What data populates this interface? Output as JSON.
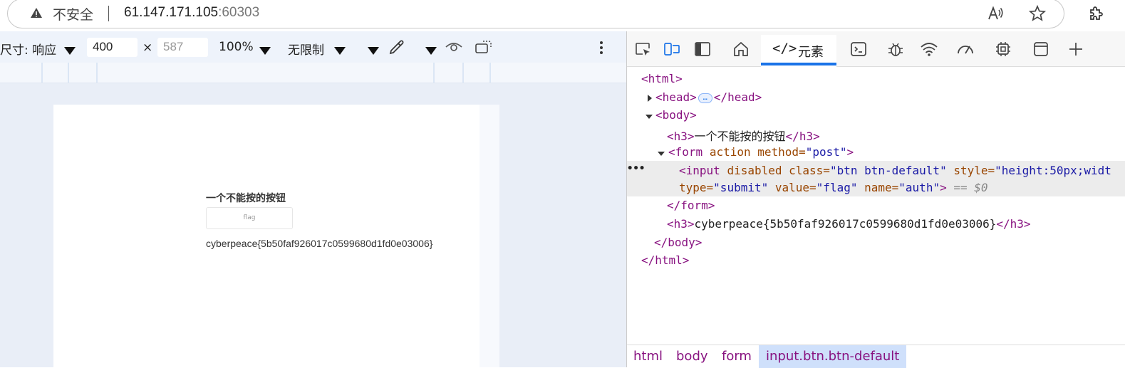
{
  "address_bar": {
    "security_label": "不安全",
    "url_host": "61.147.171.105",
    "url_port": ":60303"
  },
  "device_toolbar": {
    "size_label": "尺寸: 响应",
    "width": "400",
    "height_placeholder": "587",
    "zoom": "100%",
    "throttle": "无限制"
  },
  "page_preview": {
    "heading": "一个不能按的按钮",
    "button_label": "flag",
    "flag_text": "cyberpeace{5b50faf926017c0599680d1fd0e03006}"
  },
  "devtools": {
    "active_tab": "元素",
    "tab_code_icon": "</>",
    "dom": {
      "html_open": "<html>",
      "head": "<head>",
      "head_close": "</head>",
      "body_open": "<body>",
      "h3_open": "<h3>",
      "h3_text": "一个不能按的按钮",
      "h3_close": "</h3>",
      "form_tag": "<form",
      "form_attr1": "action",
      "form_attr2": "method=",
      "form_val2": "\"post\"",
      "form_end": ">",
      "input_tag": "<input",
      "input_attrs1": "disabled class=",
      "input_val1": "\"btn btn-default\"",
      "input_attr2": "style=",
      "input_val2": "\"height:50px;widt",
      "input_attr3": "type=",
      "input_val3": "\"submit\"",
      "input_attr4": "value=",
      "input_val4": "\"flag\"",
      "input_attr5": "name=",
      "input_val5": "\"auth\"",
      "input_end": ">",
      "selected_marker": "== $0",
      "form_close": "</form>",
      "h3_flag_text": "cyberpeace{5b50faf926017c0599680d1fd0e03006}",
      "body_close": "</body>",
      "html_close": "</html>",
      "ellipsis": "…"
    },
    "breadcrumbs": [
      "html",
      "body",
      "form",
      "input.btn.btn-default"
    ]
  },
  "colors": {
    "accent": "#1a73e8",
    "tag": "#881280",
    "attr": "#994500",
    "value": "#1a1aa6"
  }
}
